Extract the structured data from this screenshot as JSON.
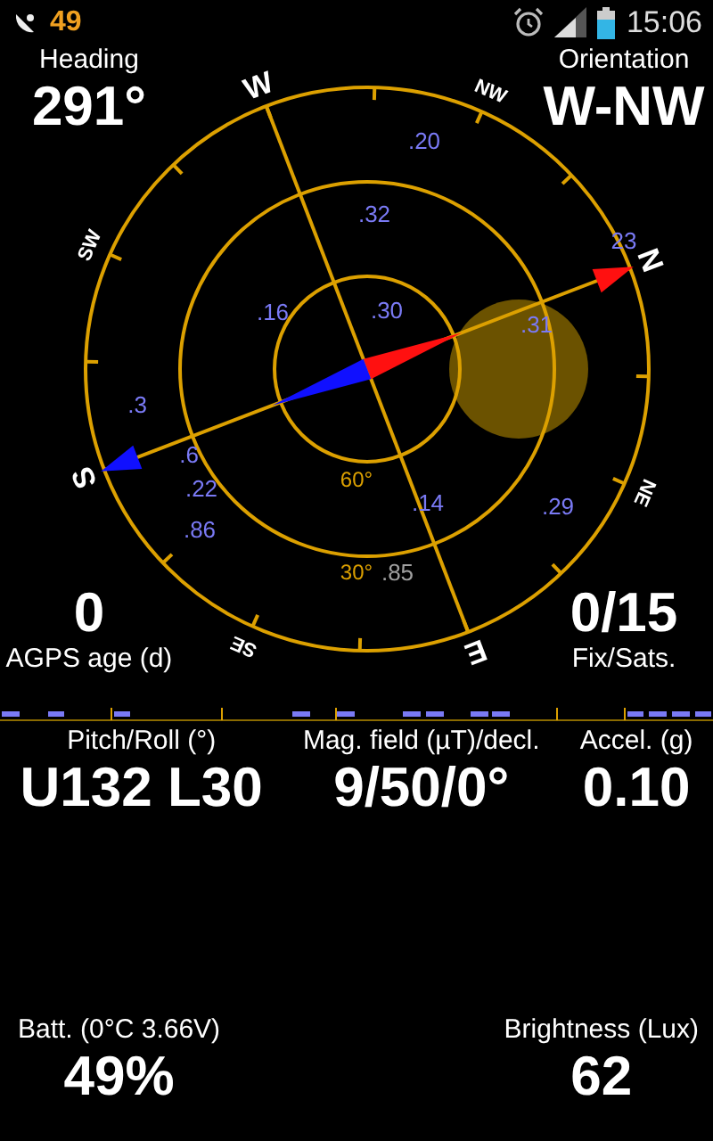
{
  "status_bar": {
    "count": "49",
    "time": "15:06"
  },
  "heading": {
    "label": "Heading",
    "value": "291°"
  },
  "orientation": {
    "label": "Orientation",
    "value": "W-NW"
  },
  "agps": {
    "value": "0",
    "label": "AGPS age (d)"
  },
  "fix": {
    "value": "0/15",
    "label": "Fix/Sats."
  },
  "compass": {
    "directions": [
      "W",
      "NW",
      "SW",
      "S",
      "SE",
      "E",
      "NE",
      "N"
    ],
    "elevation_rings": [
      "60°",
      "30°"
    ],
    "satellites": [
      {
        "label": ".20",
        "color": "#7a7af5"
      },
      {
        "label": ".32",
        "color": "#7a7af5"
      },
      {
        "label": ".16",
        "color": "#7a7af5"
      },
      {
        "label": ".30",
        "color": "#7a7af5"
      },
      {
        "label": ".31",
        "color": "#7a7af5"
      },
      {
        "label": ".3",
        "color": "#7a7af5"
      },
      {
        "label": ".6",
        "color": "#7a7af5"
      },
      {
        "label": ".22",
        "color": "#7a7af5"
      },
      {
        "label": ".86",
        "color": "#7a7af5"
      },
      {
        "label": ".14",
        "color": "#7a7af5"
      },
      {
        "label": ".29",
        "color": "#7a7af5"
      },
      {
        "label": ".85",
        "color": "#a0a0a0"
      },
      {
        "label": "23",
        "color": "#7a7af5"
      }
    ]
  },
  "metrics": [
    {
      "label": "Pitch/Roll (°)",
      "value": "U132 L30"
    },
    {
      "label": "Mag. field (µT)/decl.",
      "value": "9/50/0°"
    },
    {
      "label": "Accel. (g)",
      "value": "0.10"
    }
  ],
  "footer": [
    {
      "label": "Batt. (0°C 3.66V)",
      "value": "49%"
    },
    {
      "label": "Brightness (Lux)",
      "value": "62"
    }
  ]
}
